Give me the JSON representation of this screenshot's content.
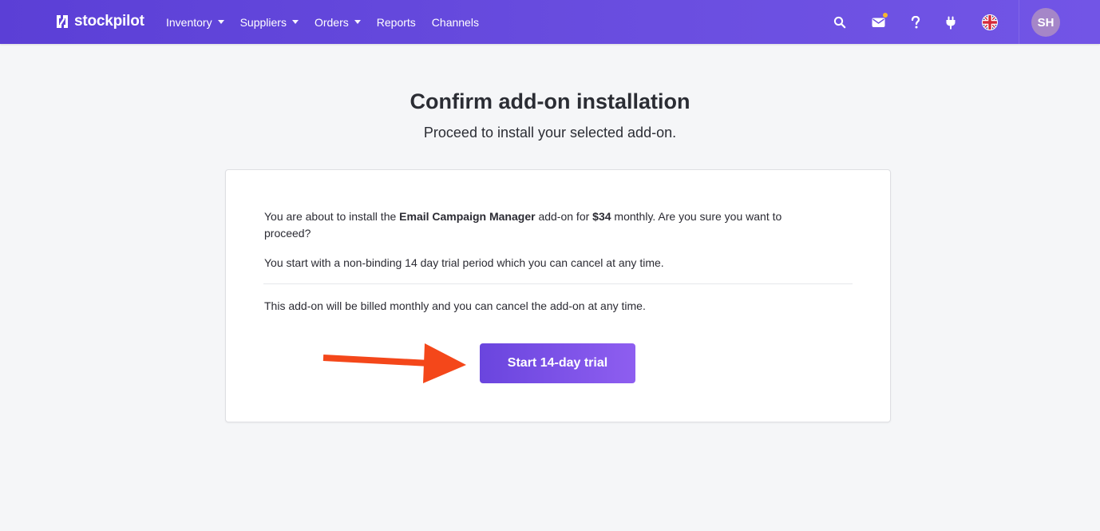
{
  "brand": {
    "name": "stockpilot"
  },
  "nav": {
    "items": [
      {
        "label": "Inventory",
        "has_menu": true
      },
      {
        "label": "Suppliers",
        "has_menu": true
      },
      {
        "label": "Orders",
        "has_menu": true
      },
      {
        "label": "Reports",
        "has_menu": false
      },
      {
        "label": "Channels",
        "has_menu": false
      }
    ]
  },
  "header_icons": [
    "search-icon",
    "mail-icon",
    "help-icon",
    "plug-icon",
    "uk-flag-icon"
  ],
  "notification_dot_color": "#f5b82e",
  "user": {
    "initials": "SH"
  },
  "page": {
    "title": "Confirm add-on installation",
    "subtitle": "Proceed to install your selected add-on."
  },
  "card": {
    "intro_before": "You are about to install the ",
    "addon_name": "Email Campaign Manager",
    "intro_middle": " add-on for ",
    "price": "$34",
    "intro_after": " monthly. Are you sure you want to proceed?",
    "trial_text": "You start with a non-binding 14 day trial period which you can cancel at any time.",
    "billing_text": "This add-on will be billed monthly and you can cancel the add-on at any time.",
    "cta_label": "Start 14-day trial"
  },
  "colors": {
    "header_gradient_start": "#5b3fd6",
    "header_gradient_end": "#7255e6",
    "cta_gradient_start": "#6a45de",
    "cta_gradient_end": "#8e5ef0",
    "annotation_arrow": "#f4471a",
    "avatar_bg": "#a586c8"
  }
}
